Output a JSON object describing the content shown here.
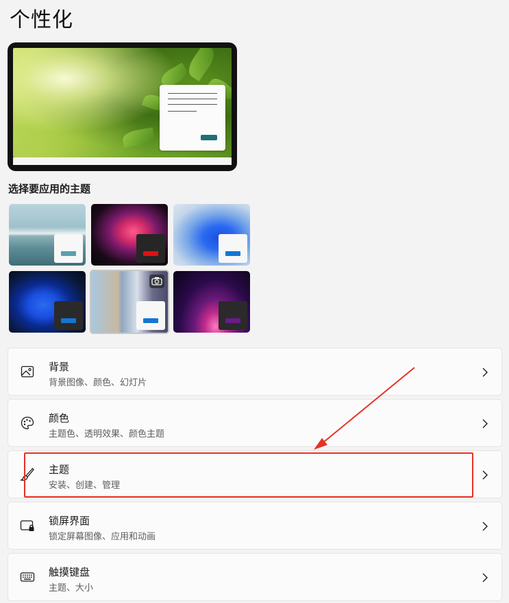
{
  "page": {
    "title": "个性化"
  },
  "themes": {
    "section_label": "选择要应用的主题",
    "items": [
      {
        "name": "theme-lake",
        "bar_color": "#5aa0b0",
        "mini_bg": "#f7f7f7"
      },
      {
        "name": "theme-glow",
        "bar_color": "#e01010",
        "mini_bg": "#262626"
      },
      {
        "name": "theme-bloom-light",
        "bar_color": "#1476d2",
        "mini_bg": "#f7f7f7"
      },
      {
        "name": "theme-bloom-dark",
        "bar_color": "#1476d2",
        "mini_bg": "#2a2a2a"
      },
      {
        "name": "theme-spotlight",
        "bar_color": "#1476d2",
        "mini_bg": "#f7f7f7",
        "selected": true,
        "badge_icon": "camera-icon"
      },
      {
        "name": "theme-flow",
        "bar_color": "#6b1a8a",
        "mini_bg": "#2a2a2a"
      }
    ]
  },
  "settings": [
    {
      "title": "背景",
      "subtitle": "背景图像、颜色、幻灯片",
      "icon": "image-icon"
    },
    {
      "title": "颜色",
      "subtitle": "主题色、透明效果、颜色主题",
      "icon": "palette-icon"
    },
    {
      "title": "主题",
      "subtitle": "安装、创建、管理",
      "icon": "brush-icon"
    },
    {
      "title": "锁屏界面",
      "subtitle": "锁定屏幕图像、应用和动画",
      "icon": "lock-screen-icon"
    },
    {
      "title": "触摸键盘",
      "subtitle": "主题、大小",
      "icon": "keyboard-icon"
    }
  ],
  "colors": {
    "annotation": "#e63224",
    "accent": "#1476d2"
  }
}
